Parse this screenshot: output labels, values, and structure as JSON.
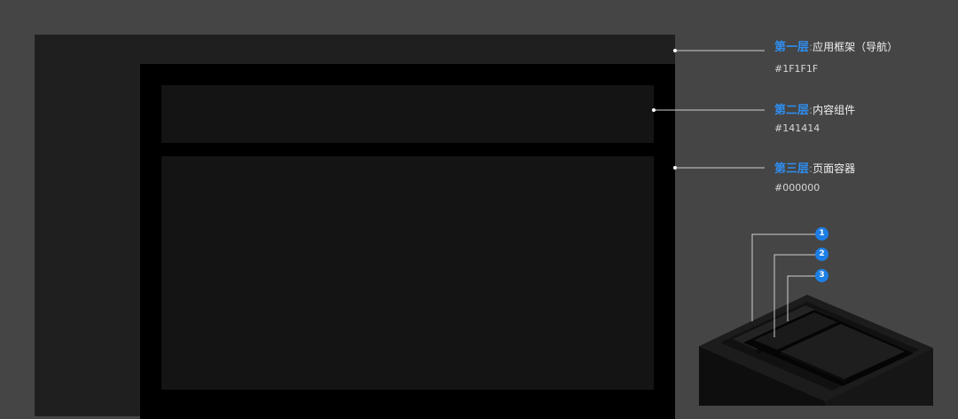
{
  "layers": [
    {
      "layer": "第一层",
      "colon": ":",
      "desc": "应用框架（导航）",
      "hex": "#1F1F1F"
    },
    {
      "layer": "第二层",
      "colon": ":",
      "desc": "内容组件",
      "hex": "#141414"
    },
    {
      "layer": "第三层",
      "colon": ":",
      "desc": "页面容器",
      "hex": "#000000"
    }
  ],
  "badges": [
    "1",
    "2",
    "3"
  ],
  "colors": {
    "background": "#454545",
    "layer1": "#1F1F1F",
    "layer2": "#141414",
    "layer3": "#000000",
    "accent": "#2F8EF0"
  }
}
